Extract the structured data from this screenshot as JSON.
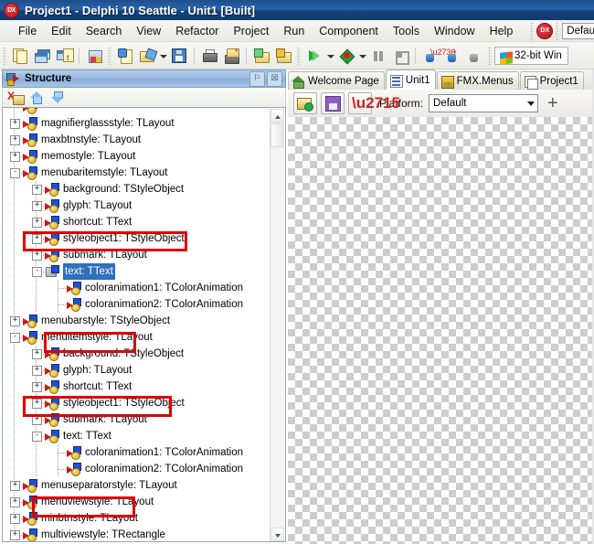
{
  "window": {
    "title": "Project1 - Delphi 10 Seattle - Unit1 [Built]",
    "app_icon": "delphi-dx-icon",
    "app_icon_label": "DX"
  },
  "menubar": {
    "items": [
      {
        "label": "File"
      },
      {
        "label": "Edit"
      },
      {
        "label": "Search"
      },
      {
        "label": "View"
      },
      {
        "label": "Refactor"
      },
      {
        "label": "Project"
      },
      {
        "label": "Run"
      },
      {
        "label": "Component"
      },
      {
        "label": "Tools"
      },
      {
        "label": "Window"
      },
      {
        "label": "Help"
      }
    ]
  },
  "toolbar": {
    "buttons": [
      {
        "name": "new-form-icon"
      },
      {
        "name": "new-window-icon"
      },
      {
        "name": "new-thread-icon"
      },
      {
        "name": "media-preview-icon"
      },
      {
        "name": "new-item-icon"
      },
      {
        "name": "open-project-icon"
      },
      {
        "name": "save-icon"
      },
      {
        "name": "print-icon"
      },
      {
        "name": "save-as-icon"
      },
      {
        "name": "add-to-project-icon"
      },
      {
        "name": "remove-from-project-icon"
      },
      {
        "name": "run-icon"
      },
      {
        "name": "run-debug-icon"
      },
      {
        "name": "pause-icon"
      },
      {
        "name": "stop-icon"
      },
      {
        "name": "trace-into-icon"
      },
      {
        "name": "step-over-icon"
      },
      {
        "name": "run-to-cursor-icon"
      }
    ],
    "personality_badge": "DX",
    "project_config": "Default",
    "target_platform": "32-bit Win",
    "platform_icon": "windows-logo-icon"
  },
  "structure_panel": {
    "title": "Structure",
    "icon": "structure-icon",
    "header_buttons": [
      {
        "name": "pin-button",
        "glyph": "⚐"
      },
      {
        "name": "close-button",
        "glyph": "☒"
      }
    ],
    "toolbar_buttons": [
      {
        "name": "delete-item-button",
        "glyph": "X"
      },
      {
        "name": "move-up-button",
        "glyph": "up"
      },
      {
        "name": "move-down-button",
        "glyph": "down"
      }
    ],
    "scrollbar": {
      "up_arrow": "scroll-up-arrow",
      "down_arrow": "scroll-down-arrow"
    },
    "tree": [
      {
        "label": "",
        "indent": 1,
        "expander": "",
        "icon": "style-node-icon",
        "selected": false,
        "partial": true
      },
      {
        "label": "magnifierglassstyle: TLayout",
        "indent": 1,
        "expander": "+",
        "icon": "style-node-icon",
        "selected": false
      },
      {
        "label": "maxbtnstyle: TLayout",
        "indent": 1,
        "expander": "+",
        "icon": "style-node-icon",
        "selected": false
      },
      {
        "label": "memostyle: TLayout",
        "indent": 1,
        "expander": "+",
        "icon": "style-node-icon",
        "selected": false
      },
      {
        "label": "menubaritemstyle: TLayout",
        "indent": 1,
        "expander": "-",
        "icon": "style-node-icon",
        "selected": false,
        "highlight": "box1"
      },
      {
        "label": "background: TStyleObject",
        "indent": 2,
        "expander": "+",
        "icon": "style-node-icon",
        "selected": false
      },
      {
        "label": "glyph: TLayout",
        "indent": 2,
        "expander": "+",
        "icon": "style-node-icon",
        "selected": false
      },
      {
        "label": "shortcut: TText",
        "indent": 2,
        "expander": "+",
        "icon": "style-node-icon",
        "selected": false
      },
      {
        "label": "styleobject1: TStyleObject",
        "indent": 2,
        "expander": "+",
        "icon": "style-node-icon",
        "selected": false
      },
      {
        "label": "submark: TLayout",
        "indent": 2,
        "expander": "+",
        "icon": "style-node-icon",
        "selected": false
      },
      {
        "label": "text: TText",
        "indent": 2,
        "expander": "-",
        "icon": "text-node-icon",
        "selected": true,
        "highlight": "box2"
      },
      {
        "label": "coloranimation1: TColorAnimation",
        "indent": 3,
        "expander": "",
        "icon": "style-node-icon",
        "selected": false
      },
      {
        "label": "coloranimation2: TColorAnimation",
        "indent": 3,
        "expander": "",
        "icon": "style-node-icon",
        "selected": false
      },
      {
        "label": "menubarstyle: TStyleObject",
        "indent": 1,
        "expander": "+",
        "icon": "style-node-icon",
        "selected": false
      },
      {
        "label": "menuitemstyle: TLayout",
        "indent": 1,
        "expander": "-",
        "icon": "style-node-icon",
        "selected": false,
        "highlight": "box3"
      },
      {
        "label": "background: TStyleObject",
        "indent": 2,
        "expander": "+",
        "icon": "style-node-icon",
        "selected": false
      },
      {
        "label": "glyph: TLayout",
        "indent": 2,
        "expander": "+",
        "icon": "style-node-icon",
        "selected": false
      },
      {
        "label": "shortcut: TText",
        "indent": 2,
        "expander": "+",
        "icon": "style-node-icon",
        "selected": false
      },
      {
        "label": "styleobject1: TStyleObject",
        "indent": 2,
        "expander": "+",
        "icon": "style-node-icon",
        "selected": false
      },
      {
        "label": "submark: TLayout",
        "indent": 2,
        "expander": "+",
        "icon": "style-node-icon",
        "selected": false
      },
      {
        "label": "text: TText",
        "indent": 2,
        "expander": "-",
        "icon": "style-node-icon",
        "selected": false,
        "highlight": "box4"
      },
      {
        "label": "coloranimation1: TColorAnimation",
        "indent": 3,
        "expander": "",
        "icon": "style-node-icon",
        "selected": false
      },
      {
        "label": "coloranimation2: TColorAnimation",
        "indent": 3,
        "expander": "",
        "icon": "style-node-icon",
        "selected": false
      },
      {
        "label": "menuseparatorstyle: TLayout",
        "indent": 1,
        "expander": "+",
        "icon": "style-node-icon",
        "selected": false
      },
      {
        "label": "menuviewstyle: TLayout",
        "indent": 1,
        "expander": "+",
        "icon": "style-node-icon",
        "selected": false
      },
      {
        "label": "minbtnstyle: TLayout",
        "indent": 1,
        "expander": "+",
        "icon": "style-node-icon",
        "selected": false
      },
      {
        "label": "multiviewstyle: TRectangle",
        "indent": 1,
        "expander": "+",
        "icon": "style-node-icon",
        "selected": false
      }
    ]
  },
  "annotations": {
    "color": "#e00000",
    "boxes": [
      {
        "name": "menubaritemstyle-highlight",
        "row": 4
      },
      {
        "name": "menubaritemstyle-text-highlight",
        "row": 10
      },
      {
        "name": "menuitemstyle-highlight",
        "row": 14
      },
      {
        "name": "menuitemstyle-text-highlight",
        "row": 20
      }
    ]
  },
  "editor_tabs": [
    {
      "label": "Welcome Page",
      "icon": "home-icon",
      "active": false
    },
    {
      "label": "Unit1",
      "icon": "unit-icon",
      "active": true
    },
    {
      "label": "FMX.Menus",
      "icon": "fmx-style-icon",
      "active": false
    },
    {
      "label": "Project1",
      "icon": "project-icon",
      "active": false
    }
  ],
  "style_designer": {
    "buttons": [
      {
        "name": "load-style-button",
        "icon": "open-folder-icon"
      },
      {
        "name": "save-style-button",
        "icon": "save-disk-icon"
      },
      {
        "name": "delete-style-button",
        "icon": "red-x-icon"
      }
    ],
    "platform_label": "Platform:",
    "platform_value": "Default",
    "add_platform_button": "+",
    "canvas": "transparent-checkerboard"
  }
}
